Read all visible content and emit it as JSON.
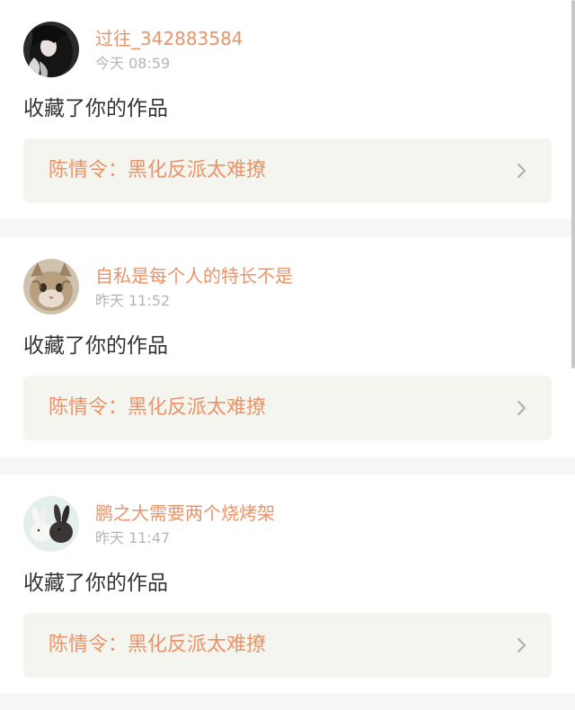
{
  "colors": {
    "accent": "#e8946a",
    "time_gray": "#b5b5b5",
    "body_text": "#333333",
    "work_bg": "#f5f5ef",
    "chevron_gray": "#b0b0b0",
    "page_bg": "#f6f6f6"
  },
  "notifications": [
    {
      "username": "过往_342883584",
      "time": "今天 08:59",
      "action": "收藏了你的作品",
      "work_title": "陈情令：黑化反派太难撩",
      "avatar_icon": "girl-dark-hair-avatar",
      "chevron_icon": "chevron-right-icon"
    },
    {
      "username": "自私是每个人的特长不是",
      "time": "昨天 11:52",
      "action": "收藏了你的作品",
      "work_title": "陈情令：黑化反派太难撩",
      "avatar_icon": "cat-avatar",
      "chevron_icon": "chevron-right-icon"
    },
    {
      "username": "鹏之大需要两个烧烤架",
      "time": "昨天 11:47",
      "action": "收藏了你的作品",
      "work_title": "陈情令：黑化反派太难撩",
      "avatar_icon": "rabbits-avatar",
      "chevron_icon": "chevron-right-icon"
    }
  ]
}
